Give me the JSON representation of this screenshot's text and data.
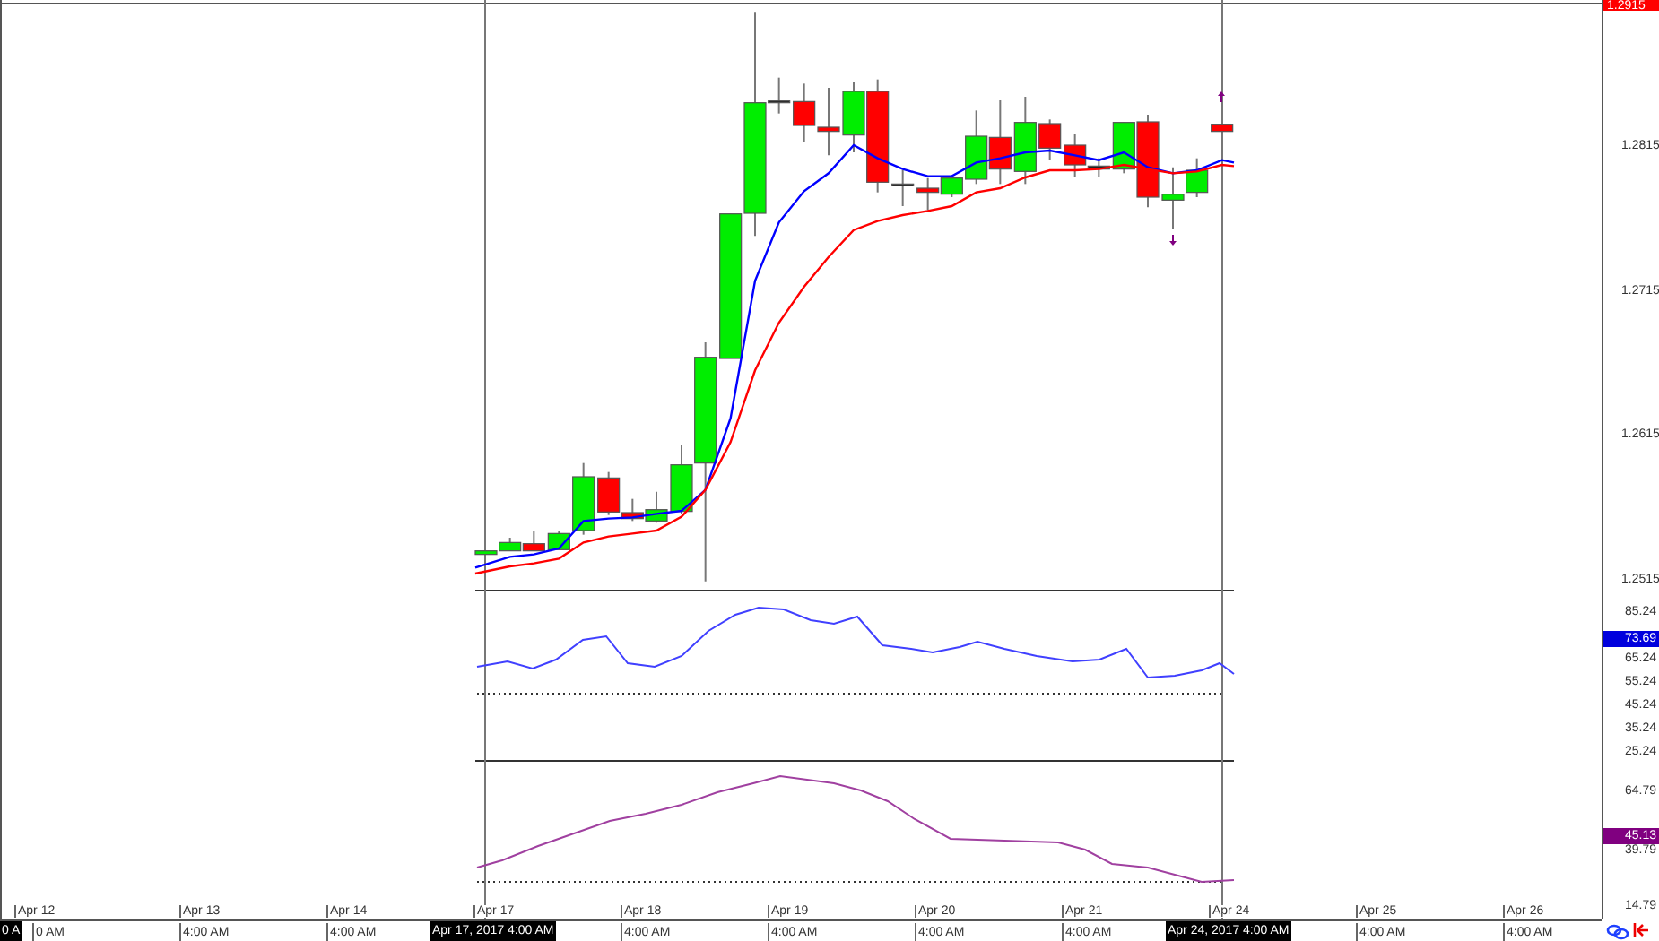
{
  "price_panel": {
    "current_price_badge": "1.2915",
    "axis_labels": [
      "1.2815",
      "1.2715",
      "1.2615",
      "1.2515"
    ]
  },
  "indicator_panel_1": {
    "axis_labels": [
      "85.24",
      "65.24",
      "55.24",
      "45.24",
      "35.24",
      "25.24"
    ],
    "value_badge": "73.69"
  },
  "indicator_panel_2": {
    "axis_labels": [
      "64.79",
      "39.79",
      "14.79"
    ],
    "value_badge": "45.13"
  },
  "time_axis": {
    "date_labels": [
      "Apr 12",
      "Apr 13",
      "Apr 14",
      "Apr 17",
      "Apr 18",
      "Apr 19",
      "Apr 20",
      "Apr 21",
      "Apr 24",
      "Apr 25",
      "Apr 26"
    ],
    "time_labels": [
      "0 AM",
      "4:00 AM",
      "4:00 AM",
      "4:00 AM",
      "4:00 AM",
      "4:00 AM",
      "4:00 AM",
      "4:00 AM",
      "4:00 AM"
    ],
    "crosshair_badges": [
      "0 A",
      "Apr 17, 2017 4:00 AM",
      "Apr 24, 2017 4:00 AM"
    ]
  }
}
